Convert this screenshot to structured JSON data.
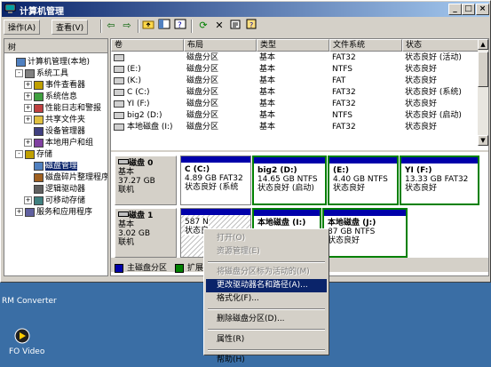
{
  "window": {
    "title": "计算机管理",
    "controls": {
      "minimize": "_",
      "maximize": "□",
      "close": "×"
    }
  },
  "menu": {
    "items": [
      "操作(A)",
      "查看(V)"
    ]
  },
  "toolbar": {
    "icons": [
      "back-icon",
      "forward-icon",
      "up-folder-icon",
      "show-hide-tree-icon",
      "help-icon",
      "refresh-icon",
      "delete-icon",
      "properties-icon",
      "help-book-icon"
    ]
  },
  "tree": {
    "header": "树",
    "nodes": [
      {
        "label": "计算机管理(本地)",
        "indent": 0,
        "pm": "",
        "selected": false
      },
      {
        "label": "系统工具",
        "indent": 1,
        "pm": "-",
        "selected": false
      },
      {
        "label": "事件查看器",
        "indent": 2,
        "pm": "+",
        "selected": false
      },
      {
        "label": "系统信息",
        "indent": 2,
        "pm": "+",
        "selected": false
      },
      {
        "label": "性能日志和警报",
        "indent": 2,
        "pm": "+",
        "selected": false
      },
      {
        "label": "共享文件夹",
        "indent": 2,
        "pm": "+",
        "selected": false
      },
      {
        "label": "设备管理器",
        "indent": 2,
        "pm": "",
        "selected": false
      },
      {
        "label": "本地用户和组",
        "indent": 2,
        "pm": "+",
        "selected": false
      },
      {
        "label": "存储",
        "indent": 1,
        "pm": "-",
        "selected": false
      },
      {
        "label": "磁盘管理",
        "indent": 2,
        "pm": "",
        "selected": true
      },
      {
        "label": "磁盘碎片整理程序",
        "indent": 2,
        "pm": "",
        "selected": false
      },
      {
        "label": "逻辑驱动器",
        "indent": 2,
        "pm": "",
        "selected": false
      },
      {
        "label": "可移动存储",
        "indent": 2,
        "pm": "+",
        "selected": false
      },
      {
        "label": "服务和应用程序",
        "indent": 1,
        "pm": "+",
        "selected": false
      }
    ]
  },
  "volumes": {
    "columns": [
      "卷",
      "布局",
      "类型",
      "文件系统",
      "状态"
    ],
    "rows": [
      {
        "vol": "",
        "layout": "磁盘分区",
        "type": "基本",
        "fs": "FAT32",
        "status": "状态良好 (活动)"
      },
      {
        "vol": "(E:)",
        "layout": "磁盘分区",
        "type": "基本",
        "fs": "NTFS",
        "status": "状态良好"
      },
      {
        "vol": "(K:)",
        "layout": "磁盘分区",
        "type": "基本",
        "fs": "FAT",
        "status": "状态良好"
      },
      {
        "vol": "C (C:)",
        "layout": "磁盘分区",
        "type": "基本",
        "fs": "FAT32",
        "status": "状态良好 (系统)"
      },
      {
        "vol": "YI (F:)",
        "layout": "磁盘分区",
        "type": "基本",
        "fs": "FAT32",
        "status": "状态良好"
      },
      {
        "vol": "big2 (D:)",
        "layout": "磁盘分区",
        "type": "基本",
        "fs": "NTFS",
        "status": "状态良好 (启动)"
      },
      {
        "vol": "本地磁盘 (I:)",
        "layout": "磁盘分区",
        "type": "基本",
        "fs": "FAT32",
        "status": "状态良好"
      }
    ]
  },
  "disks": [
    {
      "name": "磁盘 0",
      "type": "基本",
      "size": "37.27 GB",
      "state": "联机",
      "partitions": [
        {
          "name": "C (C:)",
          "detail": "4.89 GB FAT32",
          "status": "状态良好 (系统"
        },
        {
          "name": "big2 (D:)",
          "detail": "14.65 GB NTFS",
          "status": "状态良好 (启动)"
        },
        {
          "name": "(E:)",
          "detail": "4.40 GB NTFS",
          "status": "状态良好"
        },
        {
          "name": "YI (F:)",
          "detail": "13.33 GB FAT32",
          "status": "状态良好"
        }
      ]
    },
    {
      "name": "磁盘 1",
      "type": "基本",
      "size": "3.02 GB",
      "state": "联机",
      "partitions": [
        {
          "name": "",
          "detail": "587 N",
          "status": "状态良"
        },
        {
          "name": "本地磁盘 (I:)",
          "detail": "",
          "status": ""
        },
        {
          "name": "本地磁盘 (J:)",
          "detail": "87 GB NTFS",
          "status": "状态良好"
        }
      ]
    }
  ],
  "legend": {
    "primary": "主磁盘分区",
    "extended": "扩展"
  },
  "context_menu": {
    "items": [
      {
        "label": "打开(O)",
        "disabled": true,
        "highlight": false
      },
      {
        "label": "资源管理(E)",
        "disabled": true,
        "highlight": false
      },
      {
        "sep": true
      },
      {
        "label": "将磁盘分区标为活动的(M)",
        "disabled": true,
        "highlight": false
      },
      {
        "label": "更改驱动器名和路径(A)...",
        "disabled": false,
        "highlight": true
      },
      {
        "label": "格式化(F)...",
        "disabled": false,
        "highlight": false
      },
      {
        "sep": true
      },
      {
        "label": "删除磁盘分区(D)...",
        "disabled": false,
        "highlight": false
      },
      {
        "sep": true
      },
      {
        "label": "属性(R)",
        "disabled": false,
        "highlight": false
      },
      {
        "sep": true
      },
      {
        "label": "帮助(H)",
        "disabled": false,
        "highlight": false
      }
    ]
  },
  "desktop": {
    "item1": "RM Converter",
    "item2": "FO Video"
  },
  "colors": {
    "primary_partition": "#0000aa",
    "extended_partition": "#008000",
    "selection": "#0a246a"
  }
}
